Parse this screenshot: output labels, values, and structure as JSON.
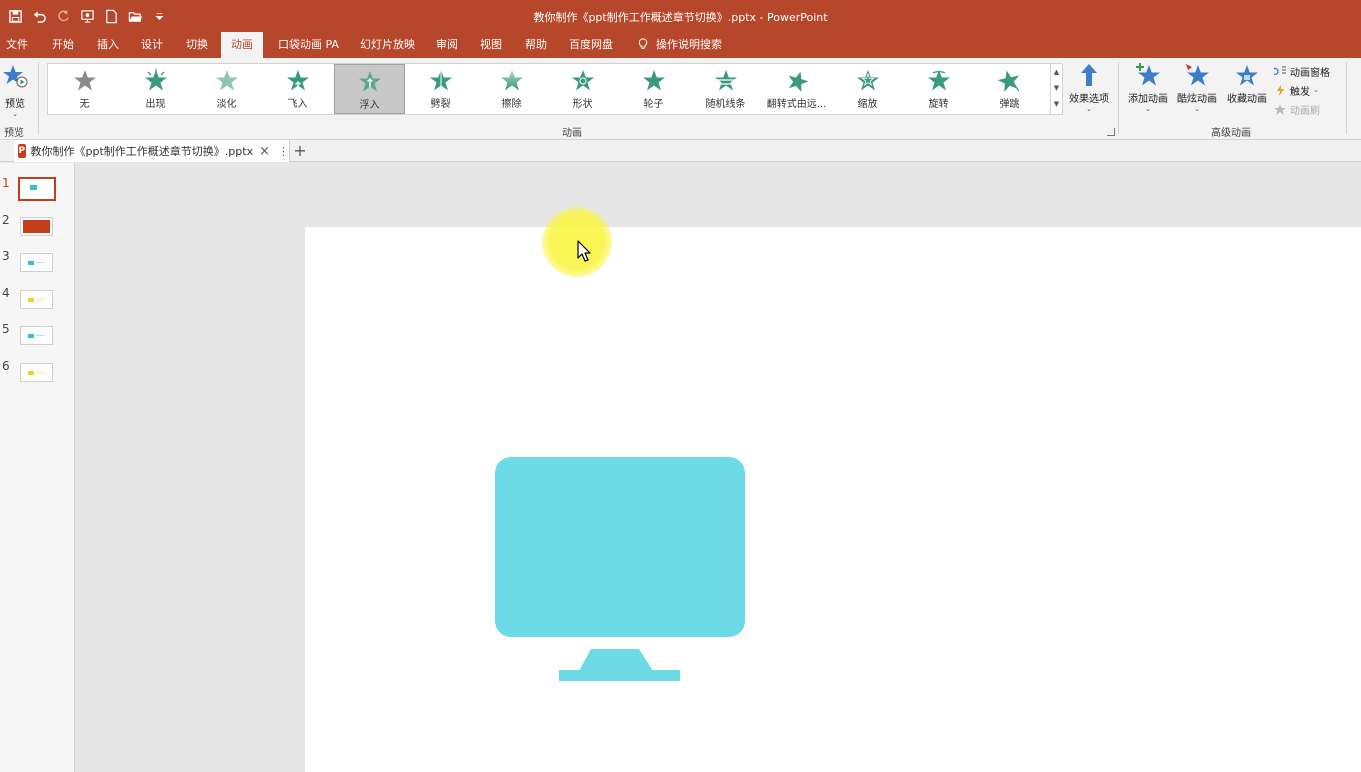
{
  "title_bar": {
    "window_title": "教你制作《ppt制作工作概述章节切换》.pptx - PowerPoint"
  },
  "tabs": [
    {
      "label": "文件",
      "active": false
    },
    {
      "label": "开始",
      "active": false
    },
    {
      "label": "插入",
      "active": false
    },
    {
      "label": "设计",
      "active": false
    },
    {
      "label": "切换",
      "active": false
    },
    {
      "label": "动画",
      "active": true
    },
    {
      "label": "口袋动画 PA",
      "active": false
    },
    {
      "label": "幻灯片放映",
      "active": false
    },
    {
      "label": "审阅",
      "active": false
    },
    {
      "label": "视图",
      "active": false
    },
    {
      "label": "帮助",
      "active": false
    },
    {
      "label": "百度网盘",
      "active": false
    }
  ],
  "tell_me": "操作说明搜索",
  "ribbon": {
    "preview_label": "预览",
    "preview_group": "预览",
    "animation_group": "动画",
    "advanced_group": "高级动画",
    "gallery": [
      {
        "label": "无",
        "selected": false,
        "icon": "star-gray-icon"
      },
      {
        "label": "出现",
        "selected": false,
        "icon": "star-burst-icon"
      },
      {
        "label": "淡化",
        "selected": false,
        "icon": "star-fade-icon"
      },
      {
        "label": "飞入",
        "selected": false,
        "icon": "star-fly-icon"
      },
      {
        "label": "浮入",
        "selected": true,
        "icon": "star-float-icon"
      },
      {
        "label": "劈裂",
        "selected": false,
        "icon": "star-split-icon"
      },
      {
        "label": "擦除",
        "selected": false,
        "icon": "star-wipe-icon"
      },
      {
        "label": "形状",
        "selected": false,
        "icon": "star-shape-icon"
      },
      {
        "label": "轮子",
        "selected": false,
        "icon": "star-wheel-icon"
      },
      {
        "label": "随机线条",
        "selected": false,
        "icon": "star-lines-icon"
      },
      {
        "label": "翻转式由远...",
        "selected": false,
        "icon": "star-flip-icon"
      },
      {
        "label": "缩放",
        "selected": false,
        "icon": "star-zoom-icon"
      },
      {
        "label": "旋转",
        "selected": false,
        "icon": "star-spin-icon"
      },
      {
        "label": "弹跳",
        "selected": false,
        "icon": "star-bounce-icon"
      }
    ],
    "effect_options": "效果选项",
    "add_animation": "添加动画",
    "cool_animation": "酷炫动画",
    "collect_animation": "收藏动画",
    "animation_pane": "动画窗格",
    "trigger": "触发",
    "animation_painter": "动画刷"
  },
  "document_tab": {
    "name": "教你制作《ppt制作工作概述章节切换》.pptx"
  },
  "thumbnails": [
    {
      "number": "1",
      "active": true,
      "accent": "#3bbfd0"
    },
    {
      "number": "2",
      "active": false,
      "accent": "#c43e1c"
    },
    {
      "number": "3",
      "active": false,
      "accent": "#3bbfd0"
    },
    {
      "number": "4",
      "active": false,
      "accent": "#f2d024"
    },
    {
      "number": "5",
      "active": false,
      "accent": "#3bbfd0"
    },
    {
      "number": "6",
      "active": false,
      "accent": "#f2d024"
    }
  ],
  "colors": {
    "brand": "#b7472a",
    "monitor": "#6ddbe6",
    "highlight": "#f8f24a"
  }
}
